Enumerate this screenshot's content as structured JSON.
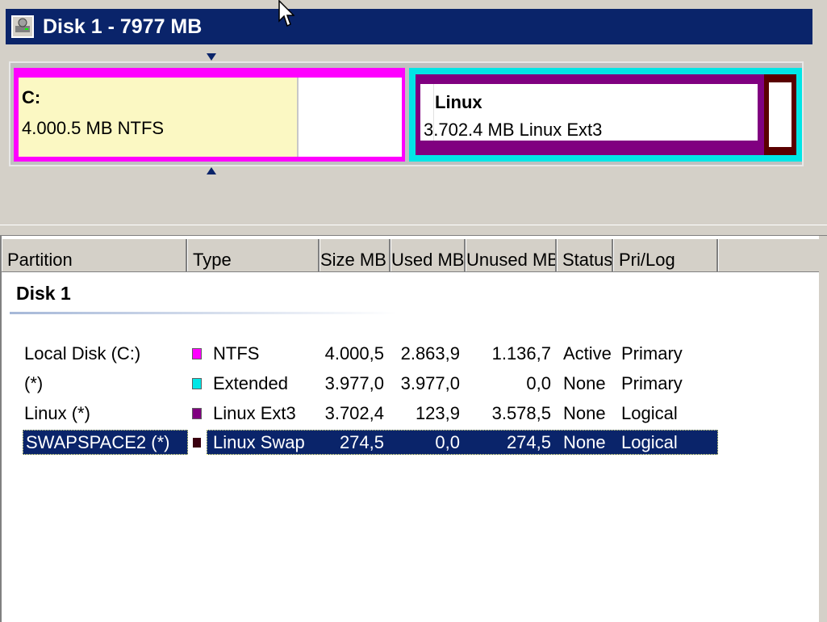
{
  "disk_map": {
    "title": "Disk 1 - 7977 MB",
    "partitions": {
      "c": {
        "name": "C:",
        "detail": "4.000.5 MB    NTFS",
        "color": "#ff00ff"
      },
      "extended": {
        "color": "#00e6e6"
      },
      "linux": {
        "name": "Linux",
        "detail": "3.702.4 MB    Linux Ext3",
        "color": "#800080"
      },
      "swap": {
        "color": "#5a0000"
      }
    }
  },
  "list": {
    "columns": [
      "Partition",
      "Type",
      "Size MB",
      "Used MB",
      "Unused MB",
      "Status",
      "Pri/Log"
    ],
    "group": "Disk 1",
    "rows": [
      {
        "partition": "Local Disk (C:)",
        "type": "NTFS",
        "size": "4.000,5",
        "used": "2.863,9",
        "unused": "1.136,7",
        "status": "Active",
        "prilog": "Primary",
        "color": "#ff00ff"
      },
      {
        "partition": "(*)",
        "type": "Extended",
        "size": "3.977,0",
        "used": "3.977,0",
        "unused": "0,0",
        "status": "None",
        "prilog": "Primary",
        "color": "#00e6e6"
      },
      {
        "partition": "Linux (*)",
        "type": "Linux Ext3",
        "size": "3.702,4",
        "used": "123,9",
        "unused": "3.578,5",
        "status": "None",
        "prilog": "Logical",
        "color": "#800080"
      },
      {
        "partition": "SWAPSPACE2 (*)",
        "type": "Linux Swap",
        "size": "274,5",
        "used": "0,0",
        "unused": "274,5",
        "status": "None",
        "prilog": "Logical",
        "color": "#3a0010"
      }
    ]
  }
}
